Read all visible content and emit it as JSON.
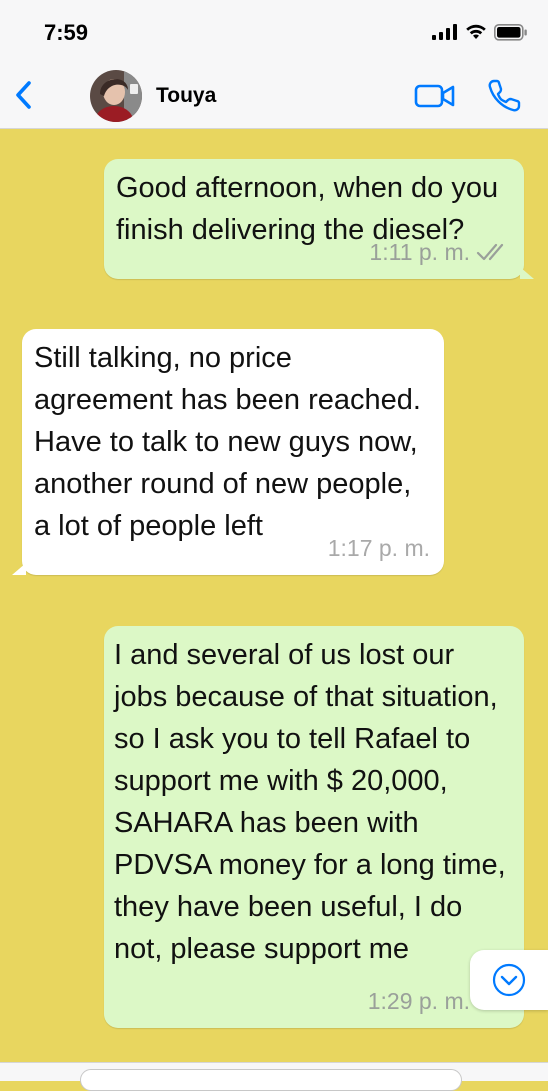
{
  "status_bar": {
    "time": "7:59"
  },
  "header": {
    "back_icon": "chevron-left-icon",
    "contact_name": "Touya",
    "video_icon": "video-camera-icon",
    "call_icon": "phone-icon"
  },
  "colors": {
    "accent": "#007aff",
    "chat_background": "#e8d65f",
    "outgoing_bubble": "#dcf8c6",
    "incoming_bubble": "#ffffff",
    "read_check": "#9aa09a"
  },
  "messages": [
    {
      "direction": "outgoing",
      "text": "Good afternoon, when do you finish delivering the diesel?",
      "time": "1:11 p. m.",
      "status_icon": "double-check-icon"
    },
    {
      "direction": "incoming",
      "text": "Still talking, no price agreement has been reached. Have to talk to new guys now, another round of new people,  a lot of people left",
      "time": "1:17 p. m."
    },
    {
      "direction": "outgoing",
      "text": "I and several of us lost our jobs because of that situation, so I ask you to tell Rafael to support me with $ 20,000, SAHARA has been with PDVSA money for a long time, they have been useful, I do not, please support me",
      "time": "1:29 p. m.",
      "status_icon": "double-check-icon"
    }
  ],
  "scroll_button_icon": "chevron-down-circle-icon"
}
